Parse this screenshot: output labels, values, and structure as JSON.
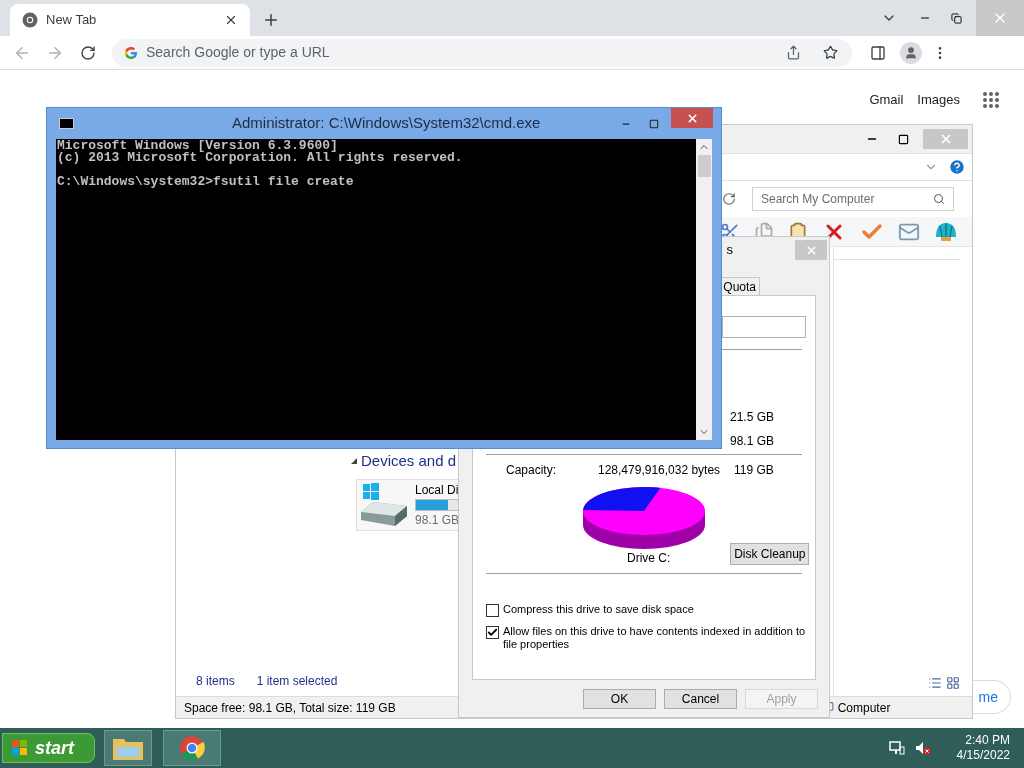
{
  "browser": {
    "tab": {
      "title": "New Tab"
    },
    "address_bar": {
      "placeholder": "Search Google or type a URL"
    },
    "links": [
      "Gmail",
      "Images"
    ],
    "customize_button": "me"
  },
  "explorer": {
    "search": {
      "placeholder": "Search My Computer"
    },
    "section": "Devices and d",
    "drive": {
      "name": "Local Di",
      "level": 0.18,
      "free": "98.1 GB"
    },
    "item_count": "8 items",
    "selection": "1 item selected",
    "space_info": "Space free: 98.1 GB, Total size: 119 GB",
    "location": "Computer"
  },
  "properties": {
    "title": "s",
    "tabs": [
      {
        "label": "Quota",
        "selected": false
      }
    ],
    "used": "21.5 GB",
    "free": "98.1 GB",
    "capacity": {
      "label": "Capacity:",
      "bytes": "128,479,916,032 bytes",
      "size": "119 GB"
    },
    "drive_label": "Drive C:",
    "cleanup_button": "Disk Cleanup",
    "options": [
      {
        "label": "Compress this drive to save disk space",
        "checked": false
      },
      {
        "label": "Allow files on this drive to have contents indexed in addition to file properties",
        "checked": true
      }
    ],
    "buttons": [
      {
        "label": "OK",
        "disabled": false
      },
      {
        "label": "Cancel",
        "disabled": false
      },
      {
        "label": "Apply",
        "disabled": true
      }
    ]
  },
  "cmd": {
    "title": "Administrator: C:\\Windows\\System32\\cmd.exe",
    "banner": [
      "Microsoft Windows [Version 6.3.9600]",
      "(c) 2013 Microsoft Corporation. All rights reserved."
    ],
    "prompt": "C:\\Windows\\system32>fsutil file create"
  },
  "taskbar": {
    "start": "start",
    "time": "2:40 PM",
    "date": "4/15/2022"
  }
}
